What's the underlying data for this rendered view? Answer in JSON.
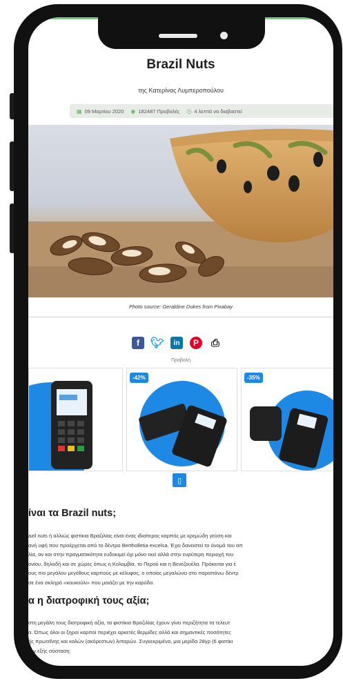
{
  "article": {
    "title": "Brazil Nuts",
    "author": "της Κατερίνας Λυμπεροπούλου",
    "meta": {
      "date": "09 Μαρτίου 2020",
      "views": "182487 Προβολές",
      "read_time": "4 λεπτά να διαβαστεί"
    },
    "photo_caption": "Photo source: Geraldine Dukes from Pixabay",
    "ad_label": "Προβολή",
    "discounts": [
      "-42%",
      "-35%"
    ],
    "sections": [
      {
        "heading": "ίναι τα Brazil nuts;",
        "lines": [
          "azil nuts ή αλλιώς φιστίκια Βραζιλίας είναι ένας ιδιαίτερος καρπός με κρεμώδη γεύση και",
          "ανή υφή που προέρχεται από το δέντρο Bertholletia excelsa. Έχει δανειστεί το όνομά του απ",
          "λία, αν και στην πραγματικότητα ευδοκιμεί όχι μόνο εκεί αλλά στην ευρύτερη περιοχή του",
          "ονίου, δηλαδή και σε χώρες όπως η Κολομβία, το Περού και η Βενεζουέλα. Πρόκειται για έ",
          "ους πιο μεγάλου μεγέθους καρπούς με κέλυφος, ο οποίος μεγαλώνει στο παραπάνω δέντρ",
          "σε ένα σκληρό «κουκούλι» που μοιάζει με την καρύδα."
        ]
      },
      {
        "heading": "α η διατροφική τους αξία;",
        "lines": [
          "στη μεγάλη τους διατροφική αξία, τα φιστίκια Βραζιλίας έχουν γίνει περιζήτητα τα τελευτ",
          "α. Όπως όλοι οι ξηροί καρποί περιέχει αρκετές θερμίδες αλλά και σημαντικές ποσότητες",
          "ής πρωτεΐνης και καλών (ακόρεστων) λιπαρών. Συγκεκριμένα, μια μερίδα 28γρ (6 φιστίκι",
          "την εξής σύσταση:"
        ]
      }
    ]
  },
  "colors": {
    "accent_green": "#58b85c",
    "facebook": "#3b5998",
    "twitter": "#1da1f2",
    "linkedin": "#0e76a8",
    "pinterest": "#e60023",
    "ad_blue": "#1e88e5"
  },
  "icons": [
    "calendar-icon",
    "eye-icon",
    "clock-icon",
    "facebook-icon",
    "twitter-icon",
    "linkedin-icon",
    "pinterest-icon",
    "print-icon",
    "ad-info-icon"
  ]
}
